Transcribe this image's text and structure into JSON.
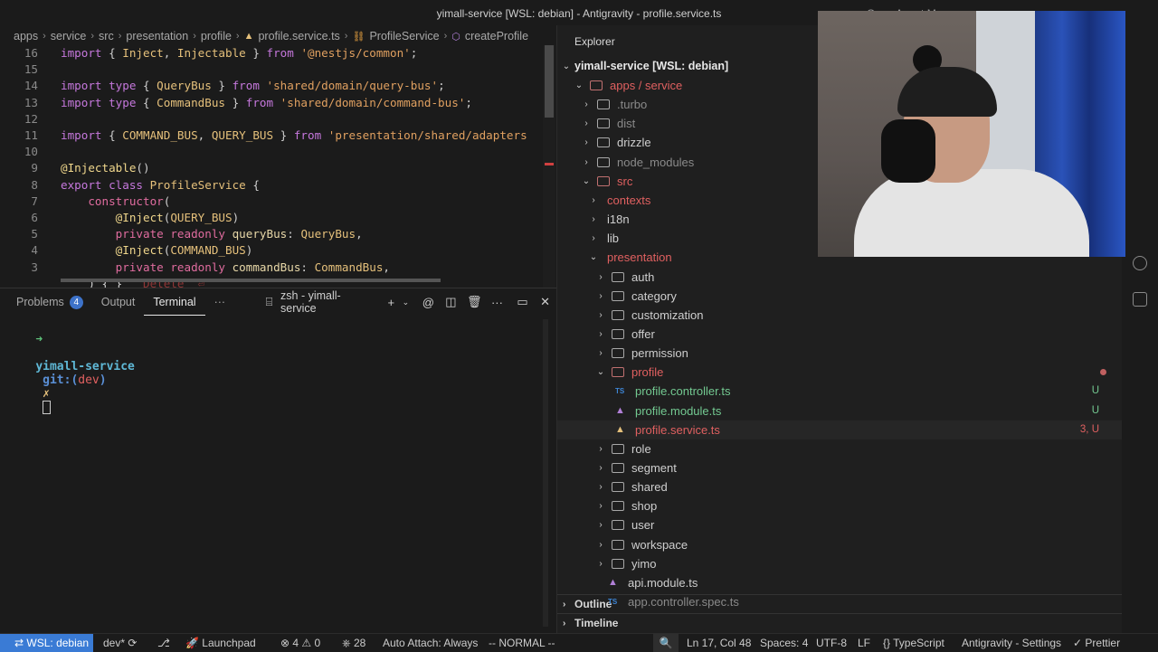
{
  "window": {
    "title": "yimall-service [WSL: debian] - Antigravity - profile.service.ts",
    "agent_label": "Open Agent Manager"
  },
  "breadcrumbs": [
    "apps",
    "service",
    "src",
    "presentation",
    "profile",
    "profile.service.ts",
    "ProfileService",
    "createProfile"
  ],
  "editor": {
    "lines": [
      {
        "num": "16",
        "tokens": [
          [
            "kw2",
            "import"
          ],
          [
            "id",
            " { "
          ],
          [
            "cls",
            "Inject"
          ],
          [
            "id",
            ", "
          ],
          [
            "cls",
            "Injectable"
          ],
          [
            "id",
            " } "
          ],
          [
            "kw2",
            "from"
          ],
          [
            "id",
            " "
          ],
          [
            "str",
            "'@nestjs/common'"
          ],
          [
            "id",
            ";"
          ]
        ]
      },
      {
        "num": "15",
        "tokens": []
      },
      {
        "num": "14",
        "tokens": [
          [
            "kw2",
            "import type"
          ],
          [
            "id",
            " { "
          ],
          [
            "cls",
            "QueryBus"
          ],
          [
            "id",
            " } "
          ],
          [
            "kw2",
            "from"
          ],
          [
            "id",
            " "
          ],
          [
            "str",
            "'shared/domain/query-bus'"
          ],
          [
            "id",
            ";"
          ]
        ]
      },
      {
        "num": "13",
        "tokens": [
          [
            "kw2",
            "import type"
          ],
          [
            "id",
            " { "
          ],
          [
            "cls",
            "CommandBus"
          ],
          [
            "id",
            " } "
          ],
          [
            "kw2",
            "from"
          ],
          [
            "id",
            " "
          ],
          [
            "str",
            "'shared/domain/command-bus'"
          ],
          [
            "id",
            ";"
          ]
        ]
      },
      {
        "num": "12",
        "tokens": []
      },
      {
        "num": "11",
        "tokens": [
          [
            "kw2",
            "import"
          ],
          [
            "id",
            " { "
          ],
          [
            "cls",
            "COMMAND_BUS"
          ],
          [
            "id",
            ", "
          ],
          [
            "cls",
            "QUERY_BUS"
          ],
          [
            "id",
            " } "
          ],
          [
            "kw2",
            "from"
          ],
          [
            "id",
            " "
          ],
          [
            "str",
            "'presentation/shared/adapters"
          ]
        ]
      },
      {
        "num": "10",
        "tokens": []
      },
      {
        "num": "9",
        "tokens": [
          [
            "dec",
            "@Injectable"
          ],
          [
            "id",
            "()"
          ]
        ]
      },
      {
        "num": "8",
        "tokens": [
          [
            "kw2",
            "export class"
          ],
          [
            "id",
            " "
          ],
          [
            "cls",
            "ProfileService"
          ],
          [
            "id",
            " {"
          ]
        ]
      },
      {
        "num": "7",
        "tokens": [
          [
            "id",
            "    "
          ],
          [
            "kw",
            "constructor"
          ],
          [
            "id",
            "("
          ]
        ]
      },
      {
        "num": "6",
        "tokens": [
          [
            "id",
            "        "
          ],
          [
            "dec",
            "@Inject"
          ],
          [
            "id",
            "("
          ],
          [
            "cls",
            "QUERY_BUS"
          ],
          [
            "id",
            ")"
          ]
        ]
      },
      {
        "num": "5",
        "tokens": [
          [
            "id",
            "        "
          ],
          [
            "kw",
            "private readonly"
          ],
          [
            "id",
            " "
          ],
          [
            "prm",
            "queryBus"
          ],
          [
            "id",
            ": "
          ],
          [
            "cls",
            "QueryBus"
          ],
          [
            "id",
            ","
          ]
        ]
      },
      {
        "num": "4",
        "tokens": [
          [
            "id",
            "        "
          ],
          [
            "dec",
            "@Inject"
          ],
          [
            "id",
            "("
          ],
          [
            "cls",
            "COMMAND_BUS"
          ],
          [
            "id",
            ")"
          ]
        ]
      },
      {
        "num": "3",
        "tokens": [
          [
            "id",
            "        "
          ],
          [
            "kw",
            "private readonly"
          ],
          [
            "id",
            " "
          ],
          [
            "prm",
            "commandBus"
          ],
          [
            "id",
            ": "
          ],
          [
            "cls",
            "CommandBus"
          ],
          [
            "id",
            ","
          ]
        ]
      },
      {
        "num": "",
        "tokens": [
          [
            "id",
            "    ) { }   "
          ],
          [
            "ghost",
            "Delete `⏎`"
          ]
        ]
      }
    ]
  },
  "panel": {
    "tabs": [
      {
        "label": "Problems",
        "badge": "4"
      },
      {
        "label": "Output",
        "badge": ""
      },
      {
        "label": "Terminal",
        "badge": ""
      }
    ],
    "more": "···",
    "terminal_name": "zsh - yimall-service",
    "prompt_arrow": "➜",
    "prompt_dir": "yimall-service",
    "prompt_git": "git:(",
    "prompt_branch": "dev",
    "prompt_close": ")",
    "prompt_x": "✗"
  },
  "explorer": {
    "header": "Explorer",
    "root": "yimall-service [WSL: debian]",
    "rows": [
      {
        "label": "apps / service",
        "indent": 1,
        "type": "folder",
        "open": true,
        "color": "#e06060",
        "chev": "⌄"
      },
      {
        "label": ".turbo",
        "indent": 2,
        "type": "folder",
        "open": false,
        "color": "#8a8a8a",
        "chev": "›"
      },
      {
        "label": "dist",
        "indent": 2,
        "type": "folder",
        "open": false,
        "color": "#8a8a8a",
        "chev": "›"
      },
      {
        "label": "drizzle",
        "indent": 2,
        "type": "folder",
        "open": false,
        "color": "#cfcfcf",
        "chev": "›"
      },
      {
        "label": "node_modules",
        "indent": 2,
        "type": "folder",
        "open": false,
        "color": "#8a8a8a",
        "chev": "›"
      },
      {
        "label": "src",
        "indent": 2,
        "type": "folder",
        "open": true,
        "color": "#e06060",
        "chev": "⌄"
      },
      {
        "label": "contexts",
        "indent": 3,
        "type": "chev-only",
        "open": false,
        "color": "#e06060",
        "chev": "›"
      },
      {
        "label": "i18n",
        "indent": 3,
        "type": "chev-only",
        "open": false,
        "color": "#cfcfcf",
        "chev": "›"
      },
      {
        "label": "lib",
        "indent": 3,
        "type": "chev-only",
        "open": false,
        "color": "#cfcfcf",
        "chev": "›"
      },
      {
        "label": "presentation",
        "indent": 3,
        "type": "chev-only",
        "open": true,
        "color": "#e06060",
        "chev": "⌄"
      },
      {
        "label": "auth",
        "indent": 4,
        "type": "folder",
        "open": false,
        "color": "#cfcfcf",
        "chev": "›"
      },
      {
        "label": "category",
        "indent": 4,
        "type": "folder",
        "open": false,
        "color": "#cfcfcf",
        "chev": "›"
      },
      {
        "label": "customization",
        "indent": 4,
        "type": "folder",
        "open": false,
        "color": "#cfcfcf",
        "chev": "›"
      },
      {
        "label": "offer",
        "indent": 4,
        "type": "folder",
        "open": false,
        "color": "#cfcfcf",
        "chev": "›"
      },
      {
        "label": "permission",
        "indent": 4,
        "type": "folder",
        "open": false,
        "color": "#cfcfcf",
        "chev": "›"
      },
      {
        "label": "profile",
        "indent": 4,
        "type": "folder",
        "open": true,
        "color": "#e06060",
        "chev": "⌄",
        "dot": true
      },
      {
        "label": "profile.controller.ts",
        "indent": 5,
        "type": "ts",
        "color": "#73c991",
        "status": "U",
        "status_color": "#73c991"
      },
      {
        "label": "profile.module.ts",
        "indent": 5,
        "type": "ng",
        "color": "#73c991",
        "status": "U",
        "status_color": "#73c991"
      },
      {
        "label": "profile.service.ts",
        "indent": 5,
        "type": "ng-y",
        "color": "#e06060",
        "status": "3, U",
        "status_color": "#e06060"
      },
      {
        "label": "role",
        "indent": 4,
        "type": "folder",
        "open": false,
        "color": "#cfcfcf",
        "chev": "›"
      },
      {
        "label": "segment",
        "indent": 4,
        "type": "folder",
        "open": false,
        "color": "#cfcfcf",
        "chev": "›"
      },
      {
        "label": "shared",
        "indent": 4,
        "type": "folder",
        "open": false,
        "color": "#cfcfcf",
        "chev": "›"
      },
      {
        "label": "shop",
        "indent": 4,
        "type": "folder",
        "open": false,
        "color": "#cfcfcf",
        "chev": "›"
      },
      {
        "label": "user",
        "indent": 4,
        "type": "folder",
        "open": false,
        "color": "#cfcfcf",
        "chev": "›"
      },
      {
        "label": "workspace",
        "indent": 4,
        "type": "folder",
        "open": false,
        "color": "#cfcfcf",
        "chev": "›"
      },
      {
        "label": "yimo",
        "indent": 4,
        "type": "folder",
        "open": false,
        "color": "#cfcfcf",
        "chev": "›"
      },
      {
        "label": "api.module.ts",
        "indent": 4,
        "type": "ng",
        "color": "#cfcfcf"
      },
      {
        "label": "app.controller.spec.ts",
        "indent": 4,
        "type": "ts",
        "color": "#8a8a8a"
      }
    ],
    "outline": "Outline",
    "timeline": "Timeline"
  },
  "statusbar": {
    "remote": "WSL: debian",
    "branch": "dev*",
    "launchpad": "Launchpad",
    "errors": "4",
    "warnings": "0",
    "ports": "28",
    "autoattach": "Auto Attach: Always",
    "vim_mode": "-- NORMAL --",
    "position": "Ln 17, Col 48",
    "spaces": "Spaces: 4",
    "encoding": "UTF-8",
    "eol": "LF",
    "language": "TypeScript",
    "settings": "Antigravity - Settings",
    "prettier": "Prettier"
  },
  "colors": {
    "accent": "#3a7bd5",
    "modified": "#e06060",
    "untracked": "#73c991"
  }
}
